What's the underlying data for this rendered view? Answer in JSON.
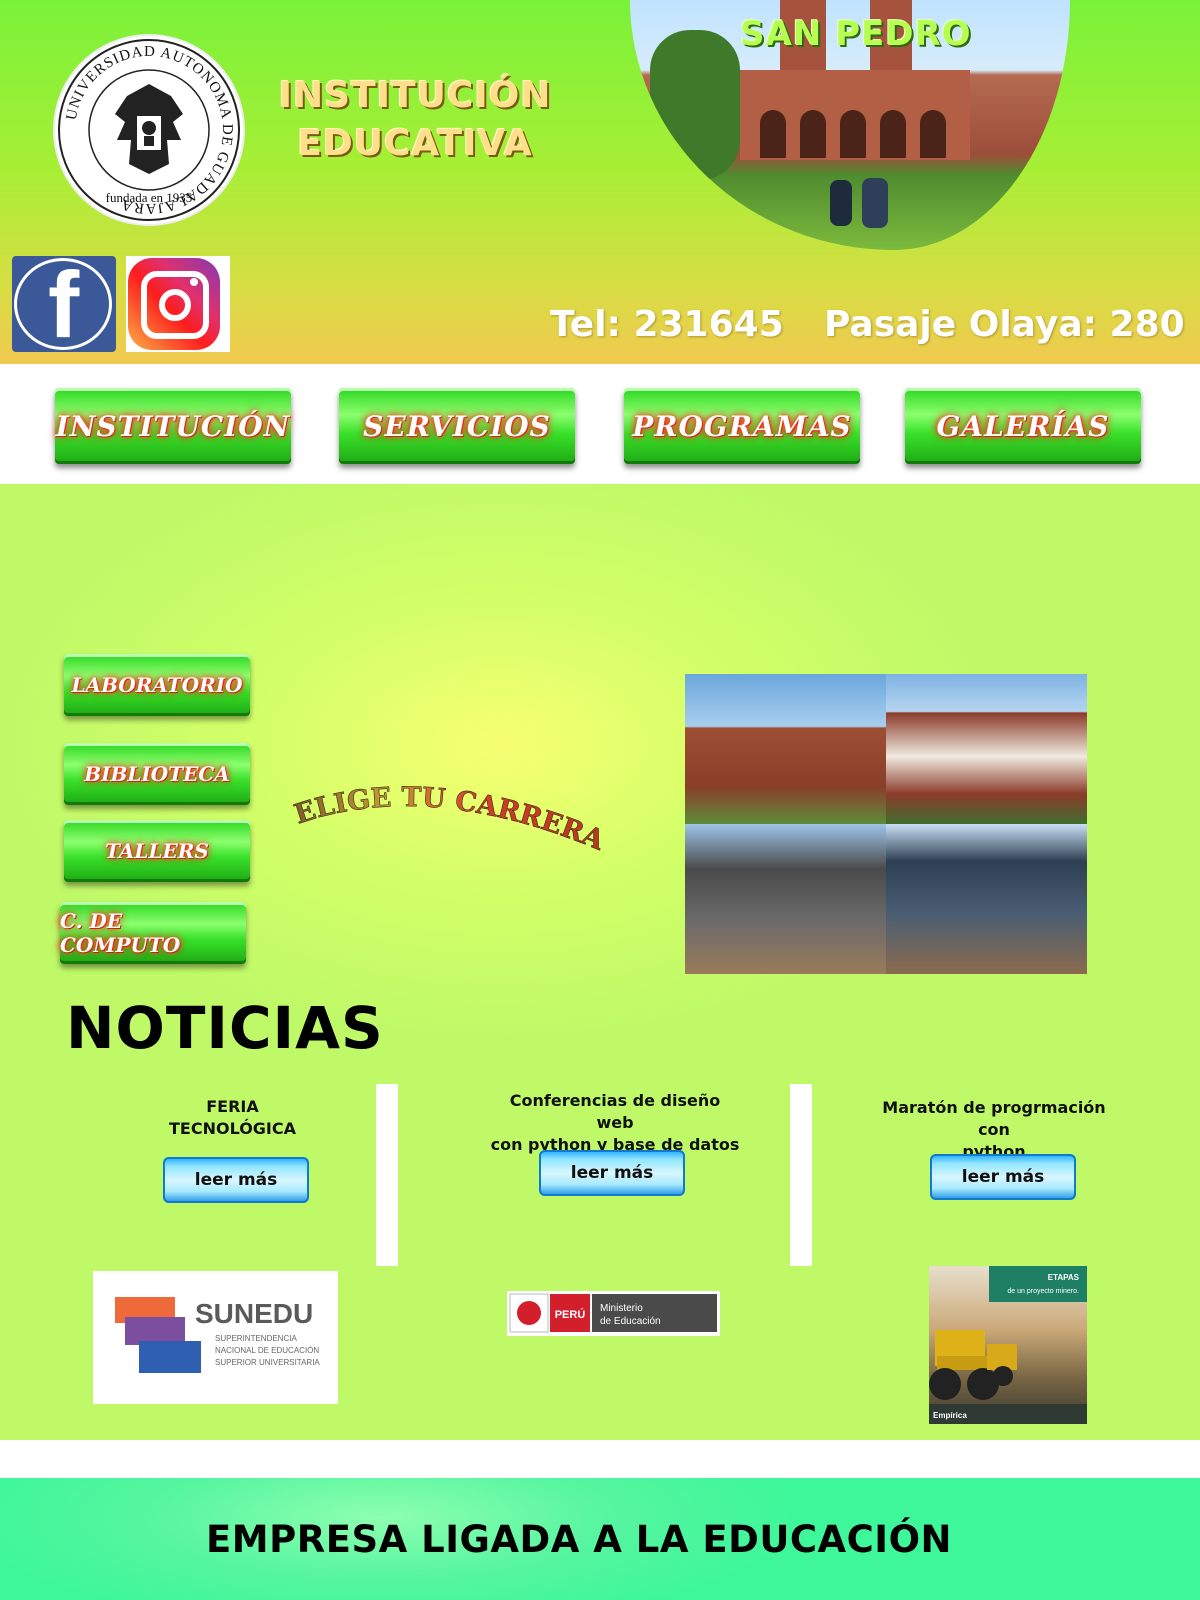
{
  "header": {
    "logo_ring_text": "UNIVERSIDAD AUTONOMA DE GUADALAJARA",
    "logo_founded": "fundada en 1935",
    "title_line1": "INSTITUCIÓN",
    "title_line2": "EDUCATIVA",
    "campus_name": "SAN PEDRO",
    "phone": "Tel: 231645",
    "address": "Pasaje Olaya: 280"
  },
  "social": {
    "facebook_icon": "facebook-icon",
    "instagram_icon": "instagram-icon"
  },
  "nav": {
    "items": [
      "INSTITUCIÓN",
      "SERVICIOS",
      "PROGRAMAS",
      "GALERÍAS"
    ]
  },
  "sidebar": {
    "items": [
      "LABORATORIO",
      "BIBLIOTECA",
      "TALLERS",
      "C. DE COMPUTO"
    ]
  },
  "hero": {
    "arc_text": "ELIGE TU CARRERA"
  },
  "news": {
    "heading": "NOTICIAS",
    "items": [
      {
        "title_line1": "FERIA",
        "title_line2": "TECNOLÓGICA",
        "button": "leer más"
      },
      {
        "title_line1": "Conferencias de diseño web",
        "title_line2": "con python y base de datos",
        "button": "leer más"
      },
      {
        "title_line1": "Maratón de progrmación con",
        "title_line2": "python",
        "button": "leer más"
      }
    ]
  },
  "partners": {
    "sunedu_name": "SUNEDU",
    "sunedu_sub1": "SUPERINTENDENCIA",
    "sunedu_sub2": "NACIONAL DE EDUCACIÓN",
    "sunedu_sub3": "SUPERIOR UNIVERSITARIA",
    "minedu_peru": "PERÚ",
    "minedu_line1": "Ministerio",
    "minedu_line2": "de Educación",
    "mining_tag1": "ETAPAS",
    "mining_tag2": "de un proyecto minero.",
    "mining_brand": "Empírica"
  },
  "footer": {
    "text": "EMPRESA LIGADA A LA EDUCACIÓN"
  },
  "colors": {
    "header_green": "#7af23a",
    "header_gold": "#f0c94f",
    "button_green": "#39e12a",
    "button_glow": "#ff2a1a",
    "main_bg": "#bff968",
    "footer_green": "#3ef79a"
  }
}
